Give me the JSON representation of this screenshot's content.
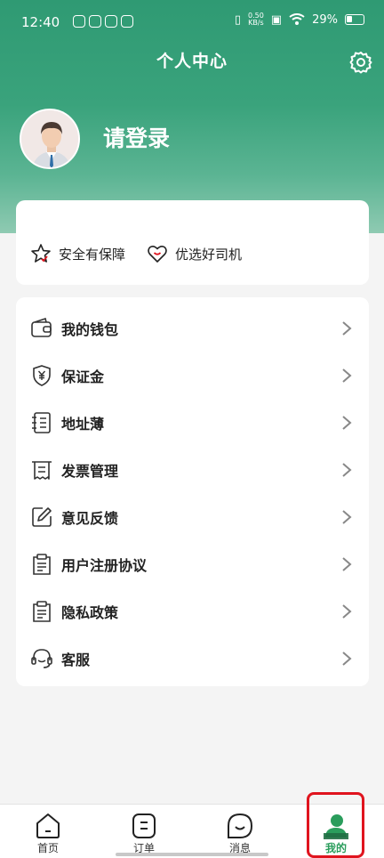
{
  "status_bar": {
    "time": "12:40",
    "net_speed_value": "0.50",
    "net_speed_unit": "KB/s",
    "battery": "29%"
  },
  "header": {
    "title": "个人中心",
    "login_text": "请登录"
  },
  "features": [
    {
      "label": "安全有保障",
      "icon": "star-check-icon"
    },
    {
      "label": "优选好司机",
      "icon": "heart-icon"
    }
  ],
  "menu": [
    {
      "label": "我的钱包",
      "icon": "wallet-icon"
    },
    {
      "label": "保证金",
      "icon": "shield-yen-icon"
    },
    {
      "label": "地址薄",
      "icon": "address-book-icon"
    },
    {
      "label": "发票管理",
      "icon": "invoice-icon"
    },
    {
      "label": "意见反馈",
      "icon": "feedback-edit-icon"
    },
    {
      "label": "用户注册协议",
      "icon": "clipboard-icon"
    },
    {
      "label": "隐私政策",
      "icon": "clipboard-icon"
    },
    {
      "label": "客服",
      "icon": "headset-icon"
    }
  ],
  "tabs": [
    {
      "label": "首页",
      "icon": "home-icon"
    },
    {
      "label": "订单",
      "icon": "orders-icon"
    },
    {
      "label": "消息",
      "icon": "message-icon"
    },
    {
      "label": "我的",
      "icon": "profile-icon"
    }
  ],
  "colors": {
    "accent": "#2a9d5c",
    "header": "#3aa37c",
    "highlight": "#e0141e"
  }
}
